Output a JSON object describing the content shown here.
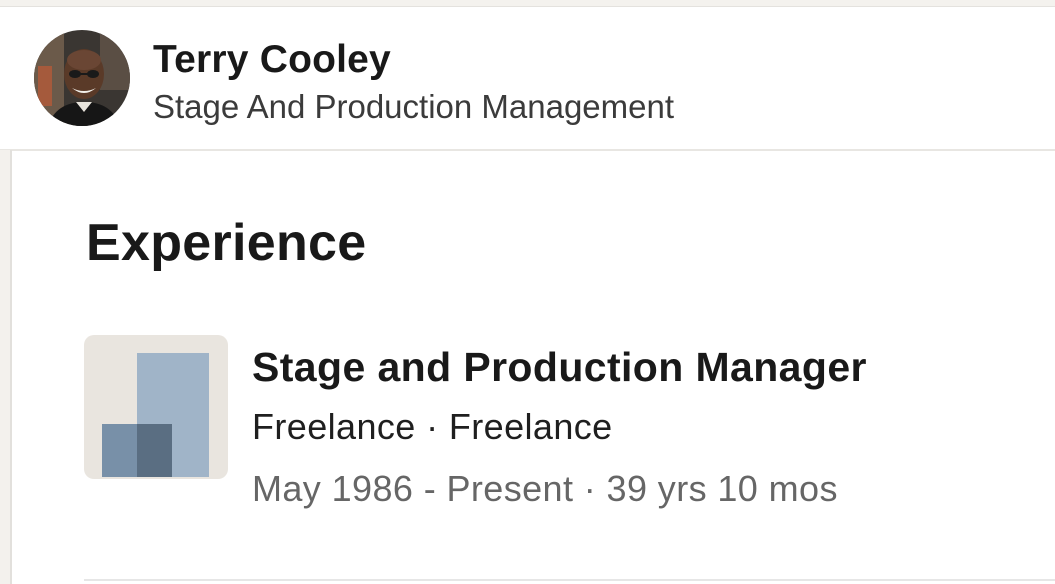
{
  "profile": {
    "name": "Terry Cooley",
    "headline": "Stage And Production Management",
    "avatar_icon": "profile-photo"
  },
  "experience": {
    "section_title": "Experience",
    "items": [
      {
        "title": "Stage and Production Manager",
        "company_line": "Freelance · Freelance",
        "dates_line": "May 1986 - Present · 39 yrs 10 mos",
        "logo_icon": "company-placeholder-logo"
      }
    ]
  },
  "colors": {
    "logo_background": "#e9e5df",
    "logo_light_block": "#a0b4c8",
    "logo_mid_block": "#7890a8",
    "logo_dark_block": "#5a6e82",
    "secondary_text": "#666666"
  }
}
